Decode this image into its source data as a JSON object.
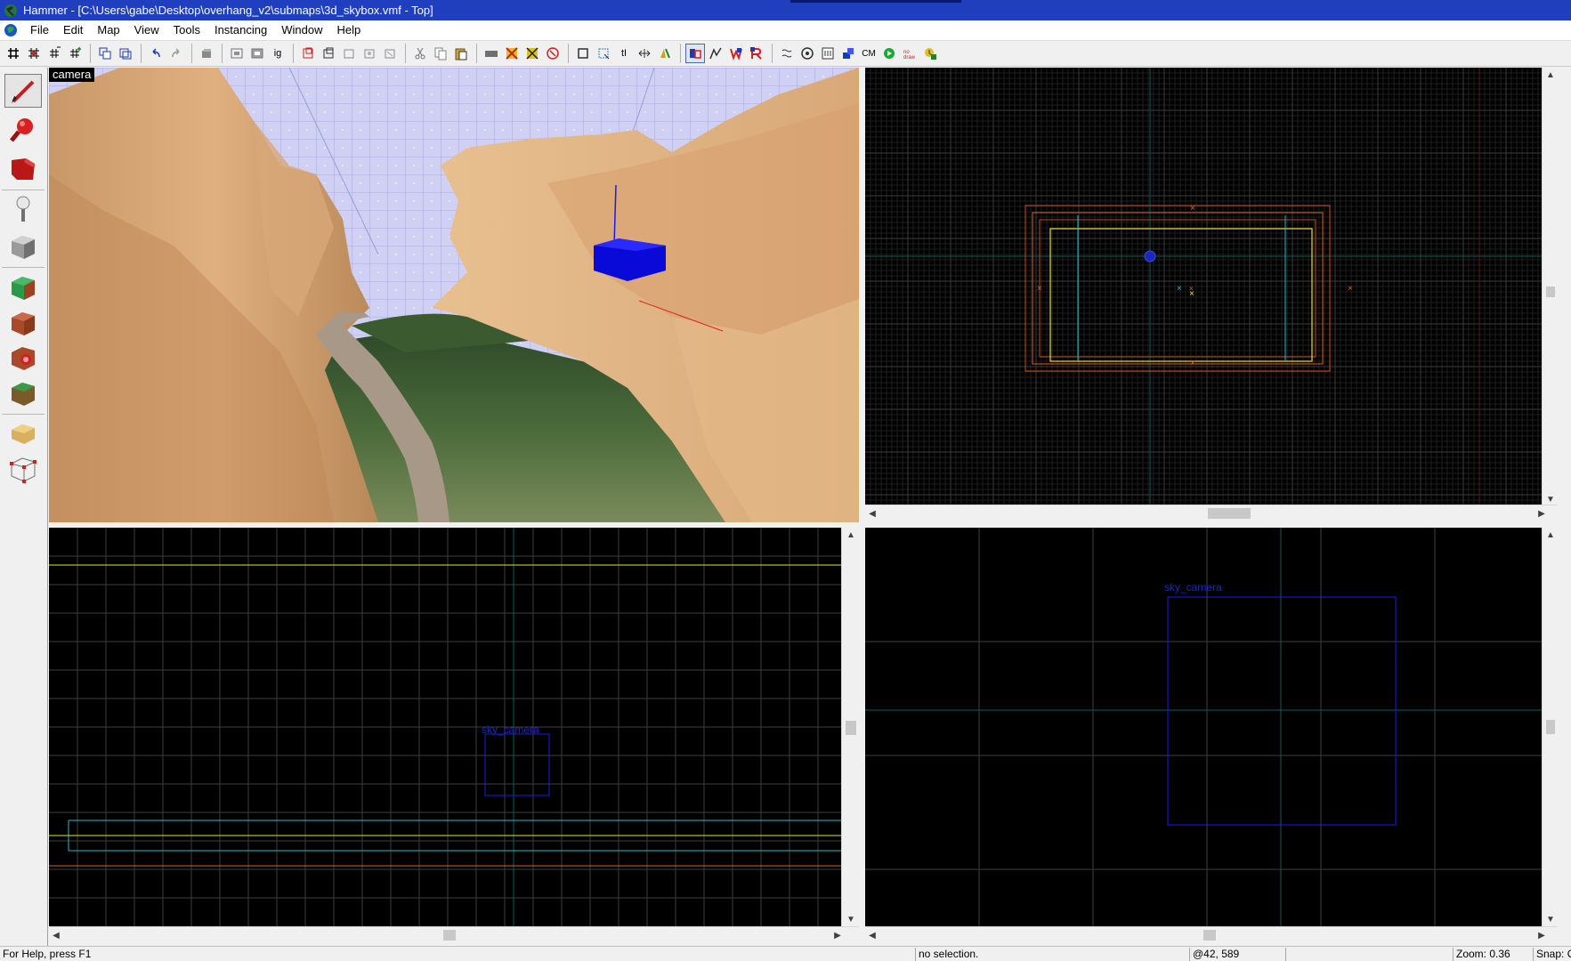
{
  "window": {
    "title": "Hammer - [C:\\Users\\gabe\\Desktop\\overhang_v2\\submaps\\3d_skybox.vmf - Top]"
  },
  "menu": {
    "items": [
      "File",
      "Edit",
      "Map",
      "View",
      "Tools",
      "Instancing",
      "Window",
      "Help"
    ]
  },
  "toolbar": {
    "cm_label": "CM",
    "buttons": [
      "grid-toggle",
      "grid-3d",
      "grid-smaller",
      "grid-larger",
      "carve",
      "hollow",
      "undo",
      "redo",
      "group",
      "ungroup",
      "ignore-grouping",
      "hide-selected",
      "hide-unselected",
      "show-all",
      "clip",
      "vertex",
      "cut",
      "copy",
      "paste",
      "toggle-texture-lock",
      "texture-application",
      "decal",
      "overlay",
      "wireframe",
      "select-faces",
      "texture-lock",
      "vertex-manipulation",
      "flip-h",
      "flip-v",
      "auto-visgroup",
      "entity-report",
      "run-map",
      "cordon",
      "compile"
    ]
  },
  "tools": [
    "selection-tool",
    "magnify-tool",
    "camera-tool",
    "entity-tool",
    "block-tool",
    "texture-application-tool",
    "apply-texture-tool",
    "decal-tool",
    "overlay-tool",
    "clipping-tool",
    "vertex-tool"
  ],
  "viewports": {
    "camera": {
      "label": "camera"
    },
    "side": {
      "object_label": "sky_camera"
    },
    "front": {
      "object_label": "sky_camera"
    }
  },
  "status": {
    "help": "For Help, press F1",
    "selection": "no selection.",
    "coords": "@42, 589",
    "zoom": "Zoom: 0.36",
    "snap": "Snap: O"
  },
  "colors": {
    "titlebar": "#1f3fbf",
    "grid_major": "#5a5a5a",
    "grid_minor": "#2a2a2a",
    "axis": "#0e6a6a",
    "selection_yellow": "#e8e030",
    "orange": "#d8602a",
    "cyan": "#2ab8c8",
    "camera_blue": "#1a1aee"
  }
}
